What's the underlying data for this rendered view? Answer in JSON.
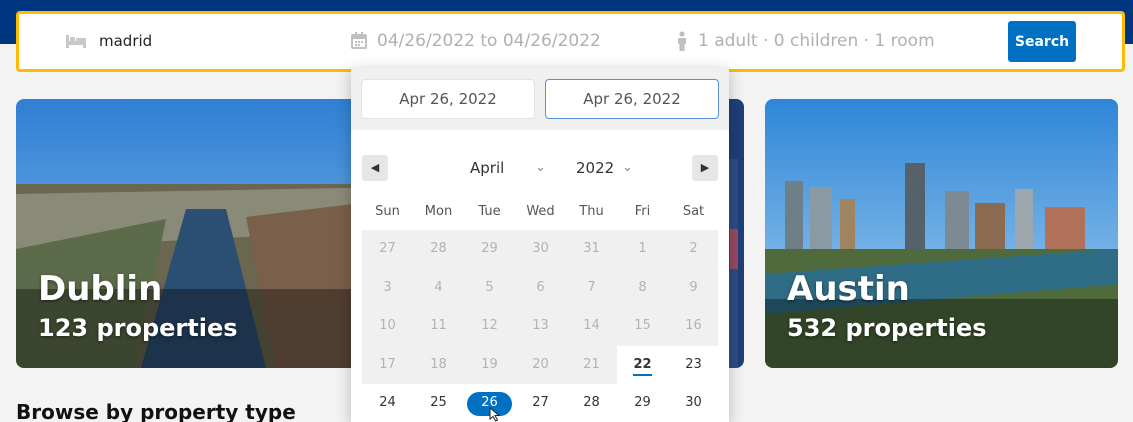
{
  "search": {
    "destination": "madrid",
    "dates": "04/26/2022 to 04/26/2022",
    "guests": "1 adult · 0 children · 1 room",
    "button_label": "Search"
  },
  "cards": [
    {
      "title": "Dublin",
      "subtitle": "123 properties"
    },
    {
      "title": "Austin",
      "subtitle": "532 properties"
    }
  ],
  "section_heading": "Browse by property type",
  "datepicker": {
    "start_date": "Apr 26, 2022",
    "end_date": "Apr 26, 2022",
    "month": "April",
    "year": "2022",
    "weekdays": [
      "Sun",
      "Mon",
      "Tue",
      "Wed",
      "Thu",
      "Fri",
      "Sat"
    ],
    "weeks": [
      [
        "27",
        "28",
        "29",
        "30",
        "31",
        "1",
        "2"
      ],
      [
        "3",
        "4",
        "5",
        "6",
        "7",
        "8",
        "9"
      ],
      [
        "10",
        "11",
        "12",
        "13",
        "14",
        "15",
        "16"
      ],
      [
        "17",
        "18",
        "19",
        "20",
        "21",
        "22",
        "23"
      ],
      [
        "24",
        "25",
        "26",
        "27",
        "28",
        "29",
        "30"
      ]
    ],
    "today": "22",
    "selected": "26"
  },
  "icons": {
    "destination": "bed-icon",
    "dates": "calendar-icon",
    "guests": "person-icon",
    "prev": "triangle-left-icon",
    "next": "triangle-right-icon"
  },
  "colors": {
    "brand_blue": "#003580",
    "button_blue": "#0071c2",
    "search_border": "#febb02"
  }
}
